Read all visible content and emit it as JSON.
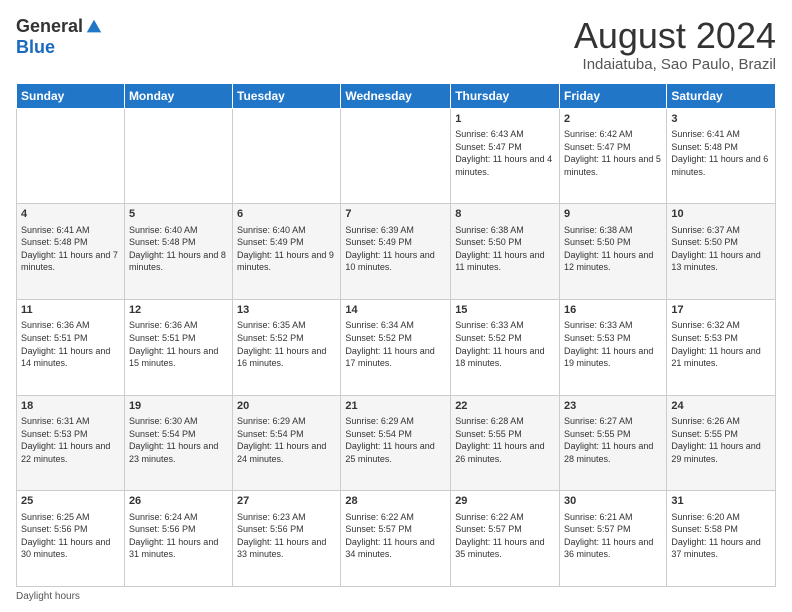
{
  "logo": {
    "general": "General",
    "blue": "Blue"
  },
  "title": {
    "month_year": "August 2024",
    "location": "Indaiatuba, Sao Paulo, Brazil"
  },
  "days_of_week": [
    "Sunday",
    "Monday",
    "Tuesday",
    "Wednesday",
    "Thursday",
    "Friday",
    "Saturday"
  ],
  "weeks": [
    [
      {
        "day": "",
        "info": ""
      },
      {
        "day": "",
        "info": ""
      },
      {
        "day": "",
        "info": ""
      },
      {
        "day": "",
        "info": ""
      },
      {
        "day": "1",
        "info": "Sunrise: 6:43 AM\nSunset: 5:47 PM\nDaylight: 11 hours and 4 minutes."
      },
      {
        "day": "2",
        "info": "Sunrise: 6:42 AM\nSunset: 5:47 PM\nDaylight: 11 hours and 5 minutes."
      },
      {
        "day": "3",
        "info": "Sunrise: 6:41 AM\nSunset: 5:48 PM\nDaylight: 11 hours and 6 minutes."
      }
    ],
    [
      {
        "day": "4",
        "info": "Sunrise: 6:41 AM\nSunset: 5:48 PM\nDaylight: 11 hours and 7 minutes."
      },
      {
        "day": "5",
        "info": "Sunrise: 6:40 AM\nSunset: 5:48 PM\nDaylight: 11 hours and 8 minutes."
      },
      {
        "day": "6",
        "info": "Sunrise: 6:40 AM\nSunset: 5:49 PM\nDaylight: 11 hours and 9 minutes."
      },
      {
        "day": "7",
        "info": "Sunrise: 6:39 AM\nSunset: 5:49 PM\nDaylight: 11 hours and 10 minutes."
      },
      {
        "day": "8",
        "info": "Sunrise: 6:38 AM\nSunset: 5:50 PM\nDaylight: 11 hours and 11 minutes."
      },
      {
        "day": "9",
        "info": "Sunrise: 6:38 AM\nSunset: 5:50 PM\nDaylight: 11 hours and 12 minutes."
      },
      {
        "day": "10",
        "info": "Sunrise: 6:37 AM\nSunset: 5:50 PM\nDaylight: 11 hours and 13 minutes."
      }
    ],
    [
      {
        "day": "11",
        "info": "Sunrise: 6:36 AM\nSunset: 5:51 PM\nDaylight: 11 hours and 14 minutes."
      },
      {
        "day": "12",
        "info": "Sunrise: 6:36 AM\nSunset: 5:51 PM\nDaylight: 11 hours and 15 minutes."
      },
      {
        "day": "13",
        "info": "Sunrise: 6:35 AM\nSunset: 5:52 PM\nDaylight: 11 hours and 16 minutes."
      },
      {
        "day": "14",
        "info": "Sunrise: 6:34 AM\nSunset: 5:52 PM\nDaylight: 11 hours and 17 minutes."
      },
      {
        "day": "15",
        "info": "Sunrise: 6:33 AM\nSunset: 5:52 PM\nDaylight: 11 hours and 18 minutes."
      },
      {
        "day": "16",
        "info": "Sunrise: 6:33 AM\nSunset: 5:53 PM\nDaylight: 11 hours and 19 minutes."
      },
      {
        "day": "17",
        "info": "Sunrise: 6:32 AM\nSunset: 5:53 PM\nDaylight: 11 hours and 21 minutes."
      }
    ],
    [
      {
        "day": "18",
        "info": "Sunrise: 6:31 AM\nSunset: 5:53 PM\nDaylight: 11 hours and 22 minutes."
      },
      {
        "day": "19",
        "info": "Sunrise: 6:30 AM\nSunset: 5:54 PM\nDaylight: 11 hours and 23 minutes."
      },
      {
        "day": "20",
        "info": "Sunrise: 6:29 AM\nSunset: 5:54 PM\nDaylight: 11 hours and 24 minutes."
      },
      {
        "day": "21",
        "info": "Sunrise: 6:29 AM\nSunset: 5:54 PM\nDaylight: 11 hours and 25 minutes."
      },
      {
        "day": "22",
        "info": "Sunrise: 6:28 AM\nSunset: 5:55 PM\nDaylight: 11 hours and 26 minutes."
      },
      {
        "day": "23",
        "info": "Sunrise: 6:27 AM\nSunset: 5:55 PM\nDaylight: 11 hours and 28 minutes."
      },
      {
        "day": "24",
        "info": "Sunrise: 6:26 AM\nSunset: 5:55 PM\nDaylight: 11 hours and 29 minutes."
      }
    ],
    [
      {
        "day": "25",
        "info": "Sunrise: 6:25 AM\nSunset: 5:56 PM\nDaylight: 11 hours and 30 minutes."
      },
      {
        "day": "26",
        "info": "Sunrise: 6:24 AM\nSunset: 5:56 PM\nDaylight: 11 hours and 31 minutes."
      },
      {
        "day": "27",
        "info": "Sunrise: 6:23 AM\nSunset: 5:56 PM\nDaylight: 11 hours and 33 minutes."
      },
      {
        "day": "28",
        "info": "Sunrise: 6:22 AM\nSunset: 5:57 PM\nDaylight: 11 hours and 34 minutes."
      },
      {
        "day": "29",
        "info": "Sunrise: 6:22 AM\nSunset: 5:57 PM\nDaylight: 11 hours and 35 minutes."
      },
      {
        "day": "30",
        "info": "Sunrise: 6:21 AM\nSunset: 5:57 PM\nDaylight: 11 hours and 36 minutes."
      },
      {
        "day": "31",
        "info": "Sunrise: 6:20 AM\nSunset: 5:58 PM\nDaylight: 11 hours and 37 minutes."
      }
    ]
  ],
  "footer": {
    "daylight_label": "Daylight hours"
  }
}
